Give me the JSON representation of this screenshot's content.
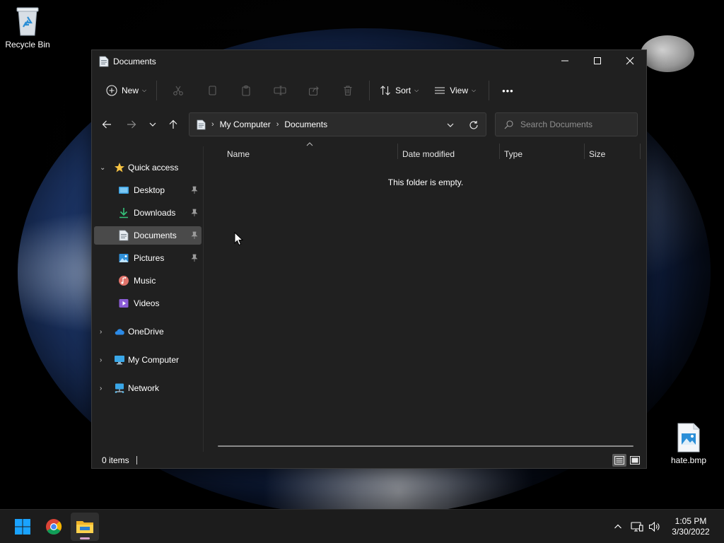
{
  "desktop": {
    "icons": [
      {
        "label": "Recycle Bin",
        "icon": "recycle-bin-icon"
      },
      {
        "label": "hate.bmp",
        "icon": "image-file-icon"
      }
    ]
  },
  "window": {
    "title": "Documents",
    "controls": {
      "minimize": "minimize-icon",
      "maximize": "maximize-icon",
      "close": "close-icon"
    }
  },
  "toolbar": {
    "new_label": "New",
    "sort_label": "Sort",
    "view_label": "View",
    "more_label": "•••",
    "disabled_actions": [
      "cut",
      "copy",
      "paste",
      "rename",
      "share",
      "delete"
    ]
  },
  "navigation": {
    "breadcrumb": [
      "My Computer",
      "Documents"
    ],
    "search_placeholder": "Search Documents"
  },
  "sidebar": {
    "quick_access": "Quick access",
    "items": [
      {
        "label": "Desktop",
        "pinned": true
      },
      {
        "label": "Downloads",
        "pinned": true
      },
      {
        "label": "Documents",
        "pinned": true,
        "selected": true
      },
      {
        "label": "Pictures",
        "pinned": true
      },
      {
        "label": "Music",
        "pinned": false
      },
      {
        "label": "Videos",
        "pinned": false
      }
    ],
    "roots": [
      {
        "label": "OneDrive"
      },
      {
        "label": "My Computer"
      },
      {
        "label": "Network"
      }
    ]
  },
  "file_list": {
    "columns": [
      "Name",
      "Date modified",
      "Type",
      "Size"
    ],
    "sort_column": "Name",
    "empty_message": "This folder is empty."
  },
  "status": {
    "item_count": "0 items"
  },
  "taskbar": {
    "apps": [
      "start-icon",
      "chrome-icon",
      "file-explorer-icon"
    ],
    "active_app": "file-explorer-icon",
    "time": "1:05 PM",
    "date": "3/30/2022"
  },
  "colors": {
    "window_bg": "#202020",
    "selection": "#4a4a4a",
    "accent_folder": "#f4c430",
    "start_blue": "#1aa3ff"
  }
}
